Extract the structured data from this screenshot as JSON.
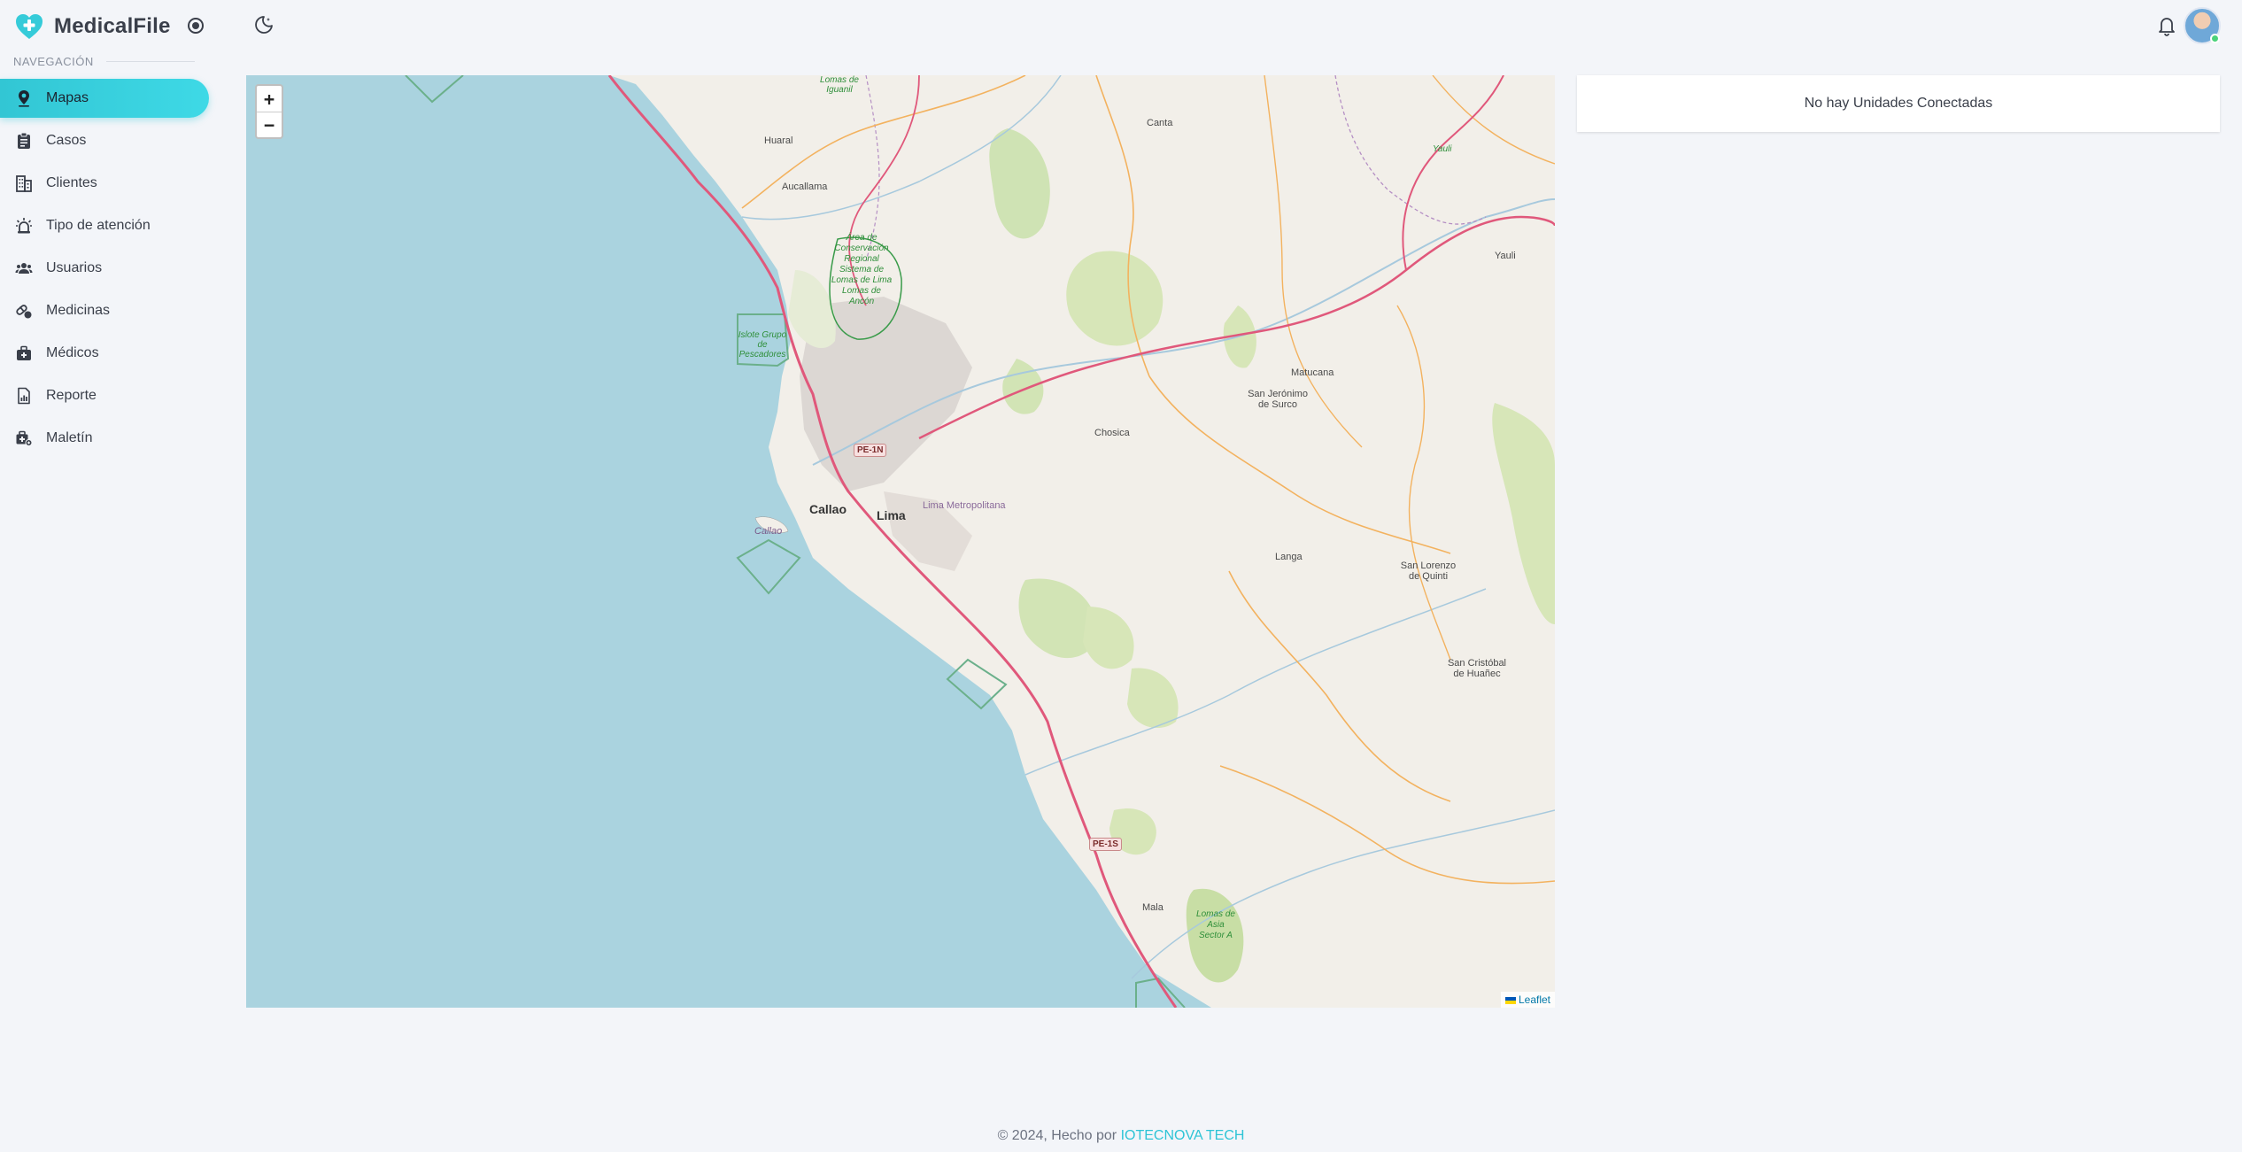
{
  "app": {
    "name": "MedicalFile",
    "accent": "#35cbd9"
  },
  "sidebar": {
    "heading": "NAVEGACIÓN",
    "items": [
      {
        "label": "Mapas",
        "icon": "map-pin-icon",
        "active": true
      },
      {
        "label": "Casos",
        "icon": "clipboard-icon"
      },
      {
        "label": "Clientes",
        "icon": "buildings-icon"
      },
      {
        "label": "Tipo de atención",
        "icon": "siren-icon"
      },
      {
        "label": "Usuarios",
        "icon": "users-icon"
      },
      {
        "label": "Medicinas",
        "icon": "pills-icon"
      },
      {
        "label": "Médicos",
        "icon": "medical-bag-icon"
      },
      {
        "label": "Reporte",
        "icon": "report-icon"
      },
      {
        "label": "Maletín",
        "icon": "medical-kit-icon"
      }
    ]
  },
  "map": {
    "zoom_in": "+",
    "zoom_out": "−",
    "attribution": "Leaflet",
    "labels": {
      "huaral": "Huaral",
      "aucallama": "Aucallama",
      "canta": "Canta",
      "lomas_iguanil": "Lomas de Iguanil",
      "area_conservacion": "Área de Conservación Regional Sistema de Lomas de Lima Lomas de Ancón",
      "islote": "Islote Grupo de Pescadores",
      "yauli_top": "Yauli",
      "yauli": "Yauli",
      "matucana": "Matucana",
      "san_jeronimo": "San Jerónimo de Surco",
      "chosica": "Chosica",
      "callao": "Callao",
      "lima": "Lima",
      "lima_metropolitana": "Lima Metropolitana",
      "callao_island": "Callao",
      "langa": "Langa",
      "san_lorenzo": "San Lorenzo de Quinti",
      "san_cristobal": "San Cristóbal de Huañec",
      "mala": "Mala",
      "lomas_asia": "Lomas de Asia Sector A",
      "pe1n": "PE-1N",
      "pe1s": "PE-1S"
    }
  },
  "panel": {
    "message": "No hay Unidades Conectadas"
  },
  "footer": {
    "prefix": "© 2024, Hecho por",
    "company": "IOTECNOVA TECH"
  }
}
